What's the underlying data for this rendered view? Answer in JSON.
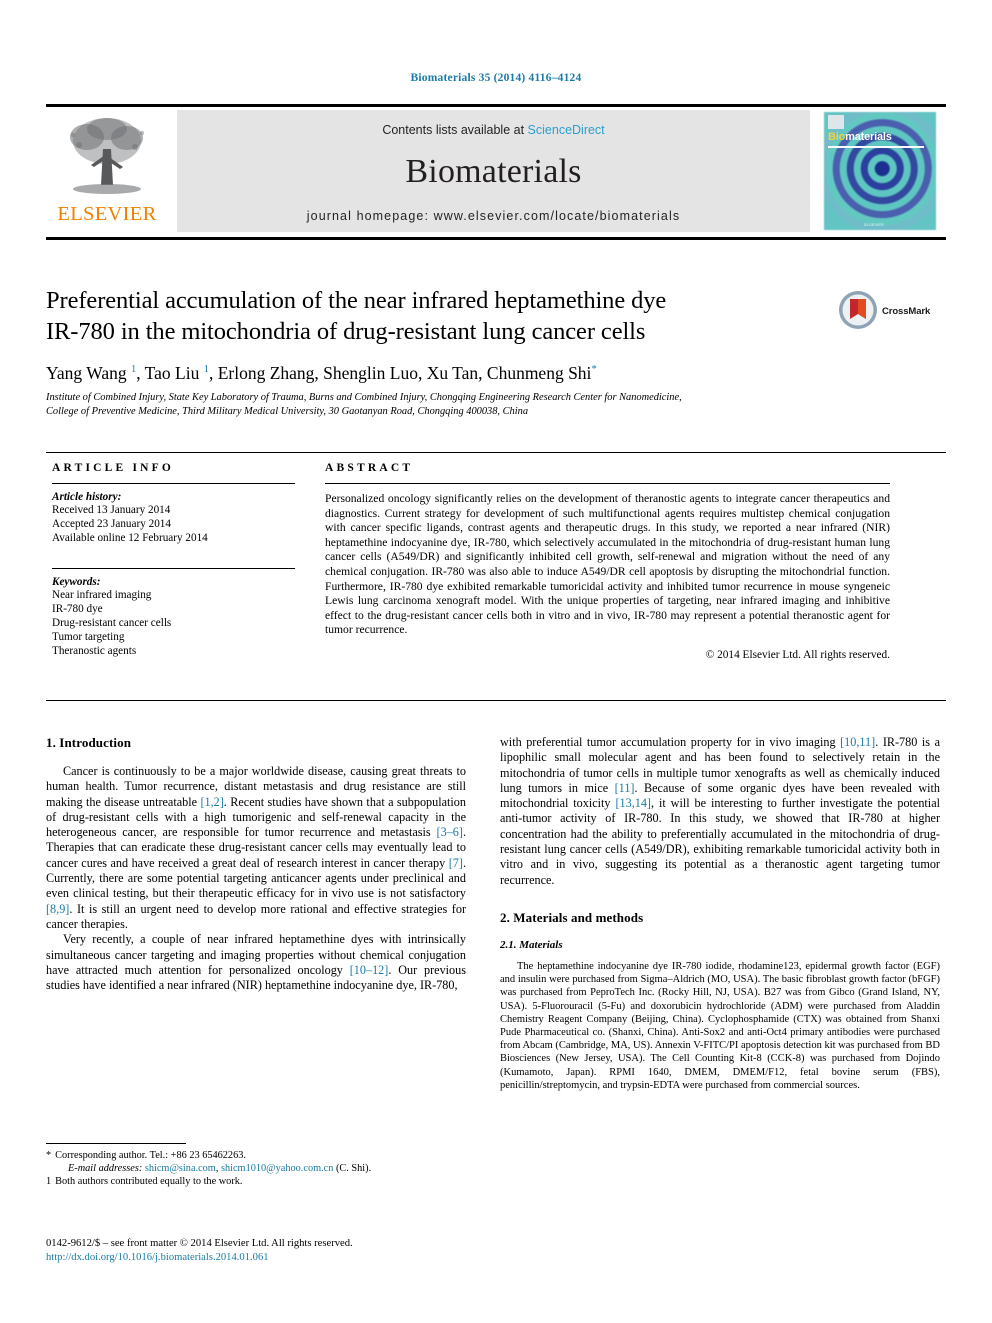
{
  "running_head": "Biomaterials 35 (2014) 4116–4124",
  "masthead": {
    "contents_prefix": "Contents lists available at",
    "sciencedirect": "ScienceDirect",
    "journal_name": "Biomaterials",
    "homepage": "journal homepage: www.elsevier.com/locate/biomaterials",
    "publisher_word": "ELSEVIER",
    "cover": {
      "title_a": "Bio",
      "title_b": "materials",
      "footer": "ELSEVIER"
    }
  },
  "title": {
    "line1": "Preferential accumulation of the near infrared heptamethine dye",
    "line2": "IR-780 in the mitochondria of drug-resistant lung cancer cells",
    "crossmark_label": "CrossMark"
  },
  "authors": {
    "list": "Yang Wang 1, Tao Liu 1, Erlong Zhang, Shenglin Luo, Xu Tan, Chunmeng Shi*",
    "affiliation_line1": "Institute of Combined Injury, State Key Laboratory of Trauma, Burns and Combined Injury, Chongqing Engineering Research Center for Nanomedicine,",
    "affiliation_line2": "College of Preventive Medicine, Third Military Medical University, 30 Gaotanyan Road, Chongqing 400038, China"
  },
  "article_info": {
    "heading": "ARTICLE INFO",
    "history_label": "Article history:",
    "history": [
      "Received 13 January 2014",
      "Accepted 23 January 2014",
      "Available online 12 February 2014"
    ],
    "keywords_label": "Keywords:",
    "keywords": [
      "Near infrared imaging",
      "IR-780 dye",
      "Drug-resistant cancer cells",
      "Tumor targeting",
      "Theranostic agents"
    ]
  },
  "abstract": {
    "heading": "ABSTRACT",
    "text": "Personalized oncology significantly relies on the development of theranostic agents to integrate cancer therapeutics and diagnostics. Current strategy for development of such multifunctional agents requires multistep chemical conjugation with cancer specific ligands, contrast agents and therapeutic drugs. In this study, we reported a near infrared (NIR) heptamethine indocyanine dye, IR-780, which selectively accumulated in the mitochondria of drug-resistant human lung cancer cells (A549/DR) and significantly inhibited cell growth, self-renewal and migration without the need of any chemical conjugation. IR-780 was also able to induce A549/DR cell apoptosis by disrupting the mitochondrial function. Furthermore, IR-780 dye exhibited remarkable tumoricidal activity and inhibited tumor recurrence in mouse syngeneic Lewis lung carcinoma xenograft model. With the unique properties of targeting, near infrared imaging and inhibitive effect to the drug-resistant cancer cells both in vitro and in vivo, IR-780 may represent a potential theranostic agent for tumor recurrence.",
    "copyright": "© 2014 Elsevier Ltd. All rights reserved."
  },
  "sections": {
    "introduction_heading": "1. Introduction",
    "intro_p1_a": "Cancer is continuously to be a major worldwide disease, causing great threats to human health. Tumor recurrence, distant metastasis and drug resistance are still making the disease untreatable ",
    "intro_p1_ref1": "[1,2]",
    "intro_p1_b": ". Recent studies have shown that a subpopulation of drug-resistant cells with a high tumorigenic and self-renewal capacity in the heterogeneous cancer, are responsible for tumor recurrence and metastasis ",
    "intro_p1_ref2": "[3–6]",
    "intro_p1_c": ". Therapies that can eradicate these drug-resistant cancer cells may eventually lead to cancer cures and have received a great deal of research interest in cancer therapy ",
    "intro_p1_ref3": "[7]",
    "intro_p1_d": ". Currently, there are some potential targeting anticancer agents under preclinical and even clinical testing, but their therapeutic efficacy for in vivo use is not satisfactory ",
    "intro_p1_ref4": "[8,9]",
    "intro_p1_e": ". It is still an urgent need to develop more rational and effective strategies for cancer therapies.",
    "intro_p2_a": "Very recently, a couple of near infrared heptamethine dyes with intrinsically simultaneous cancer targeting and imaging properties without chemical conjugation have attracted much attention for personalized oncology ",
    "intro_p2_ref1": "[10–12]",
    "intro_p2_b": ". Our previous studies have identified a near infrared (NIR) heptamethine indocyanine dye, IR-780,",
    "intro_p3_a": "with preferential tumor accumulation property for in vivo imaging ",
    "intro_p3_ref1": "[10,11]",
    "intro_p3_b": ". IR-780 is a lipophilic small molecular agent and has been found to selectively retain in the mitochondria of tumor cells in multiple tumor xenografts as well as chemically induced lung tumors in mice ",
    "intro_p3_ref2": "[11]",
    "intro_p3_c": ". Because of some organic dyes have been revealed with mitochondrial toxicity ",
    "intro_p3_ref3": "[13,14]",
    "intro_p3_d": ", it will be interesting to further investigate the potential anti-tumor activity of IR-780. In this study, we showed that IR-780 at higher concentration had the ability to preferentially accumulated in the mitochondria of drug-resistant lung cancer cells (A549/DR), exhibiting remarkable tumoricidal activity both in vitro and in vivo, suggesting its potential as a theranostic agent targeting tumor recurrence.",
    "materials_heading": "2. Materials and methods",
    "materials_subheading": "2.1. Materials",
    "materials_p1": "The heptamethine indocyanine dye IR-780 iodide, rhodamine123, epidermal growth factor (EGF) and insulin were purchased from Sigma–Aldrich (MO, USA). The basic fibroblast growth factor (bFGF) was purchased from PeproTech Inc. (Rocky Hill, NJ, USA). B27 was from Gibco (Grand Island, NY, USA). 5-Fluorouracil (5-Fu) and doxorubicin hydrochloride (ADM) were purchased from Aladdin Chemistry Reagent Company (Beijing, China). Cyclophosphamide (CTX) was obtained from Shanxi Pude Pharmaceutical co. (Shanxi, China). Anti-Sox2 and anti-Oct4 primary antibodies were purchased from Abcam (Cambridge, MA, US). Annexin V-FITC/PI apoptosis detection kit was purchased from BD Biosciences (New Jersey, USA). The Cell Counting Kit-8 (CCK-8) was purchased from Dojindo (Kumamoto, Japan). RPMI 1640, DMEM, DMEM/F12, fetal bovine serum (FBS), penicillin/streptomycin, and trypsin-EDTA were purchased from commercial sources."
  },
  "footnotes": {
    "corresponding_sym": "*",
    "corresponding": "Corresponding author. Tel.: +86 23 65462263.",
    "email_label": "E-mail addresses:",
    "email1": "shicm@sina.com",
    "email_sep": ", ",
    "email2": "shicm1010@yahoo.com.cn",
    "email_suffix": " (C. Shi).",
    "equal_sym": "1",
    "equal_contrib": "Both authors contributed equally to the work."
  },
  "imprint": {
    "line1": "0142-9612/$ – see front matter © 2014 Elsevier Ltd. All rights reserved.",
    "doi": "http://dx.doi.org/10.1016/j.biomaterials.2014.01.061"
  },
  "colors": {
    "link": "#1a7ba4",
    "sciencedirect": "#2a9fd0",
    "elsevier_orange": "#F08000"
  }
}
